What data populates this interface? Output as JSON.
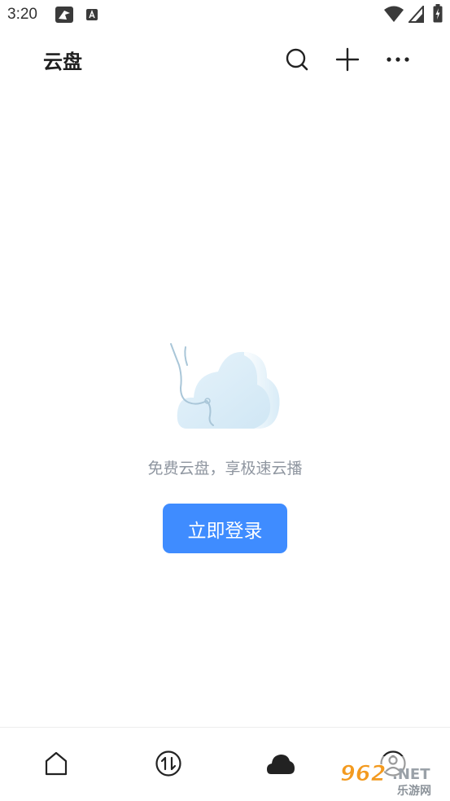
{
  "status_bar": {
    "time": "3:20",
    "icons": [
      "app-notification-icon",
      "a-keyboard-icon",
      "wifi-icon",
      "signal-icon",
      "battery-icon"
    ]
  },
  "header": {
    "title": "云盘",
    "actions": [
      "search-icon",
      "plus-icon",
      "more-icon"
    ]
  },
  "empty_state": {
    "illustration": "cloud-illustration",
    "message": "免费云盘，享极速云播",
    "login_label": "立即登录"
  },
  "tab_bar": {
    "tabs": [
      {
        "icon": "home-icon",
        "active": false
      },
      {
        "icon": "transfer-icon",
        "active": false
      },
      {
        "icon": "cloud-icon",
        "active": true
      },
      {
        "icon": "profile-icon",
        "active": false
      }
    ]
  },
  "watermark": {
    "text_top": "962.NET",
    "text_bottom": "乐游网"
  },
  "colors": {
    "accent": "#3f8cff",
    "muted_text": "#8f96a0",
    "icon": "#222222"
  }
}
